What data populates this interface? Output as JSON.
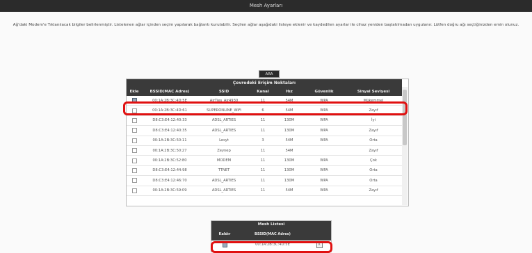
{
  "header": {
    "title": "Mesh Ayarları"
  },
  "intro": {
    "text": "Ağ'daki Modem'e Tıklanılacak bilgiler belirlenmiştir. Listelenen ağlar içinden seçim yapılarak bağlantı kurulabilir. Seçilen ağlar aşağıdaki listeye eklenir ve kaydedilen ayarlar ile cihaz yeniden başlatılmadan uygulanır. Lütfen doğru ağı seçtiğinizden emin olunuz."
  },
  "search_button": {
    "label": "ARA"
  },
  "networks": {
    "title": "Çevredeki Erişim Noktaları",
    "columns": [
      "Ekle",
      "BSSID(MAC Adres)",
      "SSID",
      "Kanal",
      "Hız",
      "Güvenlik",
      "Sinyal Seviyesi"
    ],
    "rows": [
      {
        "checked": true,
        "bssid": "00:1A:2B:3C:4D:5E",
        "ssid": "AirTies_Air4930",
        "channel": "11",
        "rate": "54M",
        "security": "WPA",
        "signal": "Mükemmel"
      },
      {
        "checked": false,
        "bssid": "00:1A:2B:3C:4D:61",
        "ssid": "SUPERONLINE_WiFi",
        "channel": "6",
        "rate": "54M",
        "security": "WPA",
        "signal": "Zayıf"
      },
      {
        "checked": false,
        "bssid": "D8:C3:E4:12:40:33",
        "ssid": "ADSL_ARTIES",
        "channel": "11",
        "rate": "130M",
        "security": "WPA",
        "signal": "İyi"
      },
      {
        "checked": false,
        "bssid": "D8:C3:E4:12:40:35",
        "ssid": "ADSL_ARTIES",
        "channel": "11",
        "rate": "130M",
        "security": "WPA",
        "signal": "Zayıf"
      },
      {
        "checked": false,
        "bssid": "00:1A:2B:3C:50:11",
        "ssid": "Lesyt",
        "channel": "3",
        "rate": "54M",
        "security": "WPA",
        "signal": "Orta"
      },
      {
        "checked": false,
        "bssid": "00:1A:2B:3C:50:27",
        "ssid": "Zeynep",
        "channel": "11",
        "rate": "54M",
        "security": "",
        "signal": "Zayıf"
      },
      {
        "checked": false,
        "bssid": "00:1A:2B:3C:52:80",
        "ssid": "MODEM",
        "channel": "11",
        "rate": "130M",
        "security": "WPA",
        "signal": "Çok"
      },
      {
        "checked": false,
        "bssid": "D8:C3:E4:12:44:98",
        "ssid": "TTNET",
        "channel": "11",
        "rate": "130M",
        "security": "WPA",
        "signal": "Orta"
      },
      {
        "checked": false,
        "bssid": "D8:C3:E4:12:46:70",
        "ssid": "ADSL_ARTIES",
        "channel": "11",
        "rate": "130M",
        "security": "WPA",
        "signal": "Orta"
      },
      {
        "checked": false,
        "bssid": "00:1A:2B:3C:59:09",
        "ssid": "ADSL_ARTIES",
        "channel": "11",
        "rate": "54M",
        "security": "WPA",
        "signal": "Zayıf"
      }
    ]
  },
  "selected": {
    "title": "Mesh Listesi",
    "columns": [
      "Kaldır",
      "BSSID(MAC Adres)"
    ],
    "rows": [
      {
        "checked": true,
        "bssid": "00:1A:2B:3C:4D:5E",
        "action": "X"
      }
    ]
  }
}
